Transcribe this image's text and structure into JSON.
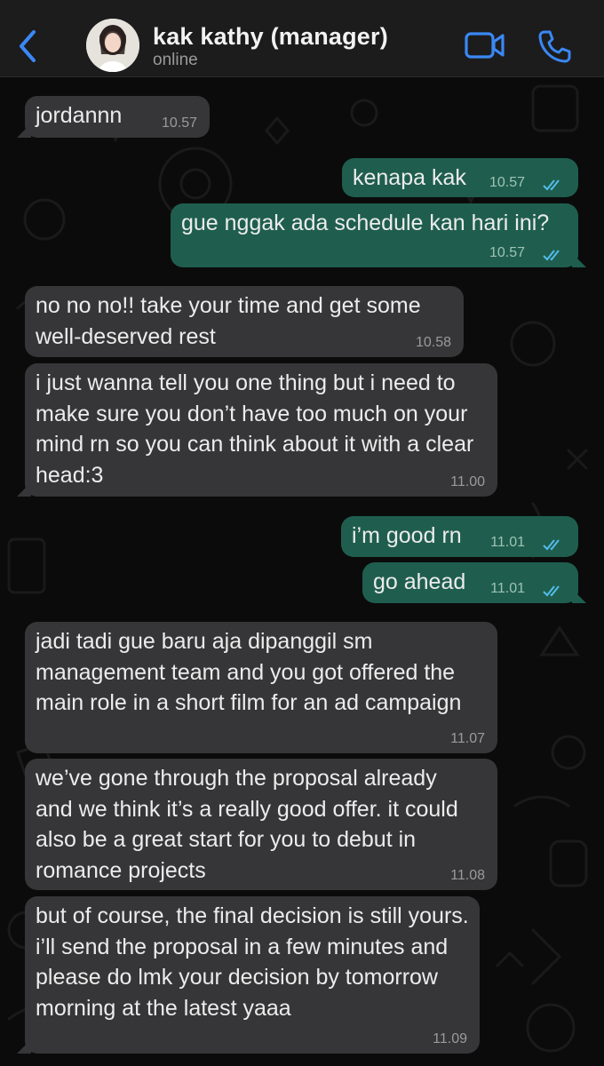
{
  "header": {
    "contact_name": "kak kathy (manager)",
    "status": "online",
    "accent_color": "#3a88f4"
  },
  "icons": {
    "back": "chevron-left-icon",
    "video": "video-camera-icon",
    "call": "phone-icon",
    "read": "double-check-icon"
  },
  "colors": {
    "incoming_bubble": "#363638",
    "outgoing_bubble": "#1f5e4e",
    "read_tick": "#53bdeb",
    "background": "#0b0b0b"
  },
  "messages": [
    {
      "direction": "in",
      "text": "jordannn",
      "time": "10.57"
    },
    {
      "direction": "out",
      "text": "kenapa kak",
      "time": "10.57",
      "read": true
    },
    {
      "direction": "out",
      "text": "gue nggak ada schedule kan hari ini?",
      "time": "10.57",
      "read": true
    },
    {
      "direction": "in",
      "text": "no no no!! take your time and get some well-deserved rest",
      "time": "10.58"
    },
    {
      "direction": "in",
      "text": "i just wanna tell you one thing but i need to make sure you don’t have too much on your mind rn so you can think about it with a clear head:3",
      "time": "11.00"
    },
    {
      "direction": "out",
      "text": "i’m good rn",
      "time": "11.01",
      "read": true
    },
    {
      "direction": "out",
      "text": "go ahead",
      "time": "11.01",
      "read": true
    },
    {
      "direction": "in",
      "text": "jadi tadi gue baru aja dipanggil sm management team and you got offered the main role in a short film for an ad campaign",
      "time": "11.07"
    },
    {
      "direction": "in",
      "text": "we’ve gone through the proposal already and we think it’s a really good offer. it could also be a great start for you to debut in romance projects",
      "time": "11.08"
    },
    {
      "direction": "in",
      "text": "but of course, the final decision is still yours. i’ll send the proposal in a few minutes and please do lmk your decision by tomorrow morning at the latest yaaa",
      "time": "11.09"
    }
  ]
}
